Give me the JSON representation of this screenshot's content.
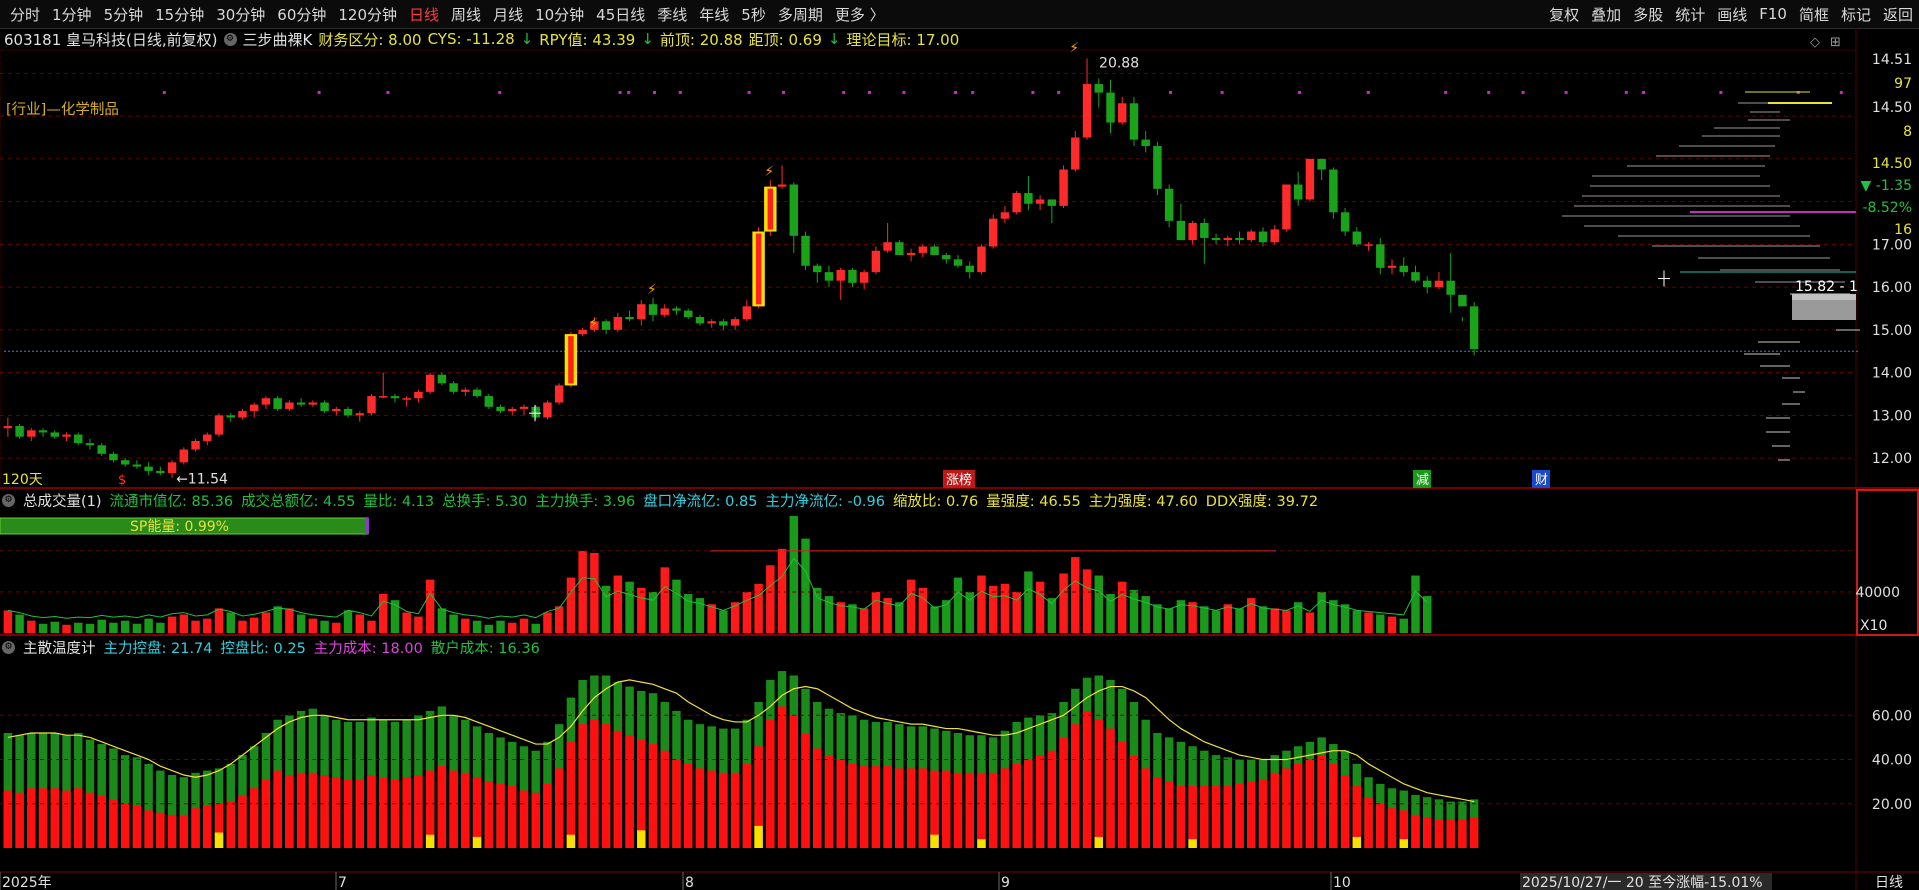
{
  "toolbar": {
    "periods": [
      "分时",
      "1分钟",
      "5分钟",
      "15分钟",
      "30分钟",
      "60分钟",
      "120分钟",
      "日线",
      "周线",
      "月线",
      "10分钟",
      "45日线",
      "季线",
      "年线",
      "5秒",
      "多周期",
      "更多 〉"
    ],
    "active_period": "日线",
    "tools": [
      "复权",
      "叠加",
      "多股",
      "统计",
      "画线",
      "F10",
      "简框",
      "标记",
      "返回"
    ]
  },
  "info_bar": {
    "code_name": "603181 皇马科技(日线,前复权)",
    "indicator": "三步曲裸K",
    "fin_score": "财务区分: 8.00",
    "cys": "CYS: -11.28",
    "rpy": "RPY值: 43.39",
    "prev_top": "前顶: 20.88",
    "dist_top": "距顶: 0.69",
    "target": "理论目标: 17.00"
  },
  "industry_label": "[行业]—化学制品",
  "main_labels": {
    "days": "120天",
    "low_marker": "←11.54",
    "high_marker": "20.88",
    "zhangbang": "涨榜",
    "jian": "减",
    "cai": "财",
    "s_mark": "$",
    "cost_price": "15.82 - 1"
  },
  "volume_bar": {
    "title": "总成交量(1)",
    "items": [
      {
        "text": "流通市值亿: 85.36",
        "color": "#20c040"
      },
      {
        "text": "成交总额亿: 4.55",
        "color": "#20c040"
      },
      {
        "text": "量比: 4.13",
        "color": "#20c040"
      },
      {
        "text": "总换手: 5.30",
        "color": "#20c040"
      },
      {
        "text": "主力换手: 3.96",
        "color": "#20c040"
      },
      {
        "text": "盘口净流亿: 0.85",
        "color": "#33d0e0"
      },
      {
        "text": "主力净流亿: -0.96",
        "color": "#33d0e0"
      },
      {
        "text": "缩放比: 0.76",
        "color": "#e8e23a"
      },
      {
        "text": "量强度: 46.55",
        "color": "#e8e23a"
      },
      {
        "text": "主力强度: 47.60",
        "color": "#e8e23a"
      },
      {
        "text": "DDX强度: 39.72",
        "color": "#e8e23a"
      }
    ],
    "sp_energy": "SP能量:   0.99%",
    "x10": "X10",
    "axis_label": "40000"
  },
  "temp_bar": {
    "title": "主散温度计",
    "items": [
      {
        "text": "主力控盘: 21.74",
        "color": "#33d0e0"
      },
      {
        "text": "控盘比: 0.25",
        "color": "#33d0e0"
      },
      {
        "text": "主力成本: 18.00",
        "color": "#e040e0"
      },
      {
        "text": "散户成本: 16.36",
        "color": "#20c040"
      }
    ]
  },
  "right_axis": {
    "top_numbers": [
      "14.51",
      "97",
      "14.50",
      "8",
      "14.50",
      "▼ -1.35",
      "-8.52%",
      "16"
    ],
    "price_ticks": [
      "17.00",
      "16.00",
      "15.00",
      "14.00",
      "13.00",
      "12.00"
    ],
    "temp_ticks": [
      "60.00",
      "40.00",
      "20.00"
    ]
  },
  "bottom_axis": {
    "labels": [
      "2025年",
      "7",
      "8",
      "9",
      "10"
    ],
    "range_text": "2025/10/27/一 20 至今涨幅-15.01%",
    "period": "日线"
  },
  "colors": {
    "up": "#ff2020",
    "down": "#1a9a1a",
    "grid": "#5a0000",
    "yellow": "#f0e000"
  },
  "chart_data": {
    "type": "candlestick",
    "ylim": [
      11.3,
      21.5
    ],
    "candles": [
      [
        12.7,
        12.95,
        12.5,
        12.75
      ],
      [
        12.75,
        12.8,
        12.45,
        12.5
      ],
      [
        12.5,
        12.7,
        12.4,
        12.65
      ],
      [
        12.65,
        12.7,
        12.5,
        12.6
      ],
      [
        12.6,
        12.65,
        12.45,
        12.5
      ],
      [
        12.5,
        12.6,
        12.4,
        12.55
      ],
      [
        12.55,
        12.6,
        12.3,
        12.35
      ],
      [
        12.35,
        12.45,
        12.2,
        12.3
      ],
      [
        12.3,
        12.35,
        12.05,
        12.1
      ],
      [
        12.1,
        12.15,
        11.9,
        11.95
      ],
      [
        11.95,
        12.0,
        11.8,
        11.85
      ],
      [
        11.85,
        11.95,
        11.75,
        11.8
      ],
      [
        11.8,
        11.9,
        11.6,
        11.7
      ],
      [
        11.7,
        11.8,
        11.6,
        11.65
      ],
      [
        11.65,
        11.95,
        11.54,
        11.9
      ],
      [
        11.9,
        12.25,
        11.85,
        12.2
      ],
      [
        12.2,
        12.45,
        12.15,
        12.4
      ],
      [
        12.4,
        12.6,
        12.3,
        12.55
      ],
      [
        12.55,
        13.05,
        12.5,
        13.0
      ],
      [
        13.0,
        13.05,
        12.85,
        12.95
      ],
      [
        12.95,
        13.15,
        12.9,
        13.1
      ],
      [
        13.1,
        13.3,
        12.95,
        13.25
      ],
      [
        13.25,
        13.45,
        13.15,
        13.4
      ],
      [
        13.4,
        13.45,
        13.1,
        13.15
      ],
      [
        13.15,
        13.35,
        13.1,
        13.3
      ],
      [
        13.3,
        13.4,
        13.2,
        13.25
      ],
      [
        13.25,
        13.35,
        13.2,
        13.3
      ],
      [
        13.3,
        13.35,
        13.05,
        13.1
      ],
      [
        13.1,
        13.2,
        13.0,
        13.15
      ],
      [
        13.15,
        13.2,
        12.95,
        13.0
      ],
      [
        13.0,
        13.1,
        12.85,
        13.05
      ],
      [
        13.05,
        13.5,
        13.0,
        13.45
      ],
      [
        13.45,
        14.0,
        13.4,
        13.45
      ],
      [
        13.45,
        13.5,
        13.3,
        13.4
      ],
      [
        13.4,
        13.45,
        13.2,
        13.4
      ],
      [
        13.4,
        13.6,
        13.3,
        13.55
      ],
      [
        13.55,
        14.0,
        13.5,
        13.95
      ],
      [
        13.95,
        14.0,
        13.7,
        13.75
      ],
      [
        13.75,
        13.8,
        13.5,
        13.55
      ],
      [
        13.55,
        13.65,
        13.45,
        13.6
      ],
      [
        13.6,
        13.65,
        13.4,
        13.45
      ],
      [
        13.45,
        13.5,
        13.15,
        13.2
      ],
      [
        13.2,
        13.25,
        13.05,
        13.1
      ],
      [
        13.1,
        13.2,
        13.0,
        13.15
      ],
      [
        13.15,
        13.25,
        13.0,
        13.2
      ],
      [
        13.2,
        13.25,
        12.9,
        12.95
      ],
      [
        12.95,
        13.35,
        12.9,
        13.3
      ],
      [
        13.3,
        13.75,
        13.25,
        13.7
      ],
      [
        13.7,
        14.95,
        13.65,
        14.9
      ],
      [
        14.9,
        15.05,
        14.85,
        15.0
      ],
      [
        15.0,
        15.3,
        14.95,
        15.2
      ],
      [
        15.2,
        15.25,
        14.9,
        15.0
      ],
      [
        15.0,
        15.4,
        14.95,
        15.3
      ],
      [
        15.3,
        15.45,
        15.2,
        15.25
      ],
      [
        15.25,
        15.7,
        15.1,
        15.6
      ],
      [
        15.6,
        15.75,
        15.2,
        15.35
      ],
      [
        15.35,
        15.6,
        15.3,
        15.5
      ],
      [
        15.5,
        15.55,
        15.35,
        15.45
      ],
      [
        15.45,
        15.5,
        15.25,
        15.3
      ],
      [
        15.3,
        15.35,
        15.1,
        15.15
      ],
      [
        15.15,
        15.25,
        15.05,
        15.2
      ],
      [
        15.2,
        15.25,
        15.0,
        15.1
      ],
      [
        15.1,
        15.3,
        15.0,
        15.25
      ],
      [
        15.25,
        15.7,
        15.2,
        15.55
      ],
      [
        15.55,
        17.4,
        15.5,
        17.3
      ],
      [
        17.3,
        18.5,
        17.2,
        18.35
      ],
      [
        18.35,
        18.85,
        18.3,
        18.4
      ],
      [
        18.4,
        18.45,
        16.8,
        17.2
      ],
      [
        17.2,
        17.3,
        16.4,
        16.5
      ],
      [
        16.5,
        16.55,
        16.1,
        16.35
      ],
      [
        16.35,
        16.5,
        16.0,
        16.15
      ],
      [
        16.15,
        16.45,
        15.7,
        16.4
      ],
      [
        16.4,
        16.45,
        16.0,
        16.1
      ],
      [
        16.1,
        16.4,
        15.95,
        16.35
      ],
      [
        16.35,
        16.95,
        16.3,
        16.85
      ],
      [
        16.85,
        17.5,
        16.8,
        17.05
      ],
      [
        17.05,
        17.1,
        16.8,
        16.75
      ],
      [
        16.75,
        16.9,
        16.6,
        16.8
      ],
      [
        16.8,
        17.0,
        16.7,
        16.95
      ],
      [
        16.95,
        17.0,
        16.75,
        16.75
      ],
      [
        16.75,
        16.8,
        16.55,
        16.65
      ],
      [
        16.65,
        16.75,
        16.45,
        16.5
      ],
      [
        16.5,
        16.6,
        16.2,
        16.35
      ],
      [
        16.35,
        17.0,
        16.3,
        16.95
      ],
      [
        16.95,
        17.7,
        16.9,
        17.6
      ],
      [
        17.6,
        17.9,
        17.5,
        17.75
      ],
      [
        17.75,
        18.25,
        17.7,
        18.2
      ],
      [
        18.2,
        18.6,
        17.8,
        17.95
      ],
      [
        17.95,
        18.15,
        17.8,
        18.05
      ],
      [
        18.05,
        17.9,
        17.5,
        17.9
      ],
      [
        17.9,
        18.85,
        17.85,
        18.75
      ],
      [
        18.75,
        19.65,
        18.7,
        19.5
      ],
      [
        19.5,
        21.35,
        19.45,
        20.75
      ],
      [
        20.75,
        20.88,
        20.2,
        20.55
      ],
      [
        20.55,
        20.85,
        19.6,
        19.85
      ],
      [
        19.85,
        20.45,
        19.8,
        20.3
      ],
      [
        20.3,
        20.45,
        19.3,
        19.45
      ],
      [
        19.45,
        19.65,
        19.15,
        19.3
      ],
      [
        19.3,
        19.4,
        18.15,
        18.3
      ],
      [
        18.3,
        18.4,
        17.4,
        17.55
      ],
      [
        17.55,
        17.95,
        17.3,
        17.1
      ],
      [
        17.1,
        17.55,
        17.0,
        17.5
      ],
      [
        17.5,
        17.6,
        16.55,
        17.15
      ],
      [
        17.15,
        17.25,
        17.0,
        17.1
      ],
      [
        17.1,
        17.2,
        16.95,
        17.15
      ],
      [
        17.15,
        17.3,
        17.0,
        17.1
      ],
      [
        17.1,
        17.35,
        17.05,
        17.3
      ],
      [
        17.3,
        17.4,
        16.95,
        17.05
      ],
      [
        17.05,
        17.45,
        17.0,
        17.35
      ],
      [
        17.35,
        18.4,
        17.3,
        18.4
      ],
      [
        18.4,
        18.7,
        17.9,
        18.05
      ],
      [
        18.05,
        19.0,
        18.0,
        19.0
      ],
      [
        19.0,
        18.95,
        18.5,
        18.75
      ],
      [
        18.75,
        18.8,
        17.6,
        17.75
      ],
      [
        17.75,
        17.85,
        17.2,
        17.3
      ],
      [
        17.3,
        17.4,
        16.95,
        17.0
      ],
      [
        17.0,
        17.05,
        16.85,
        17.0
      ],
      [
        17.0,
        17.15,
        16.3,
        16.45
      ],
      [
        16.45,
        16.65,
        16.3,
        16.5
      ],
      [
        16.5,
        16.7,
        16.25,
        16.35
      ],
      [
        16.35,
        16.5,
        16.1,
        16.15
      ],
      [
        16.15,
        16.25,
        15.85,
        16.0
      ],
      [
        16.0,
        16.35,
        15.95,
        16.15
      ],
      [
        16.15,
        16.8,
        15.4,
        15.82
      ],
      [
        15.82,
        15.3,
        15.2,
        15.55
      ],
      [
        15.55,
        15.65,
        14.4,
        14.55
      ]
    ],
    "volume": [
      22,
      18,
      12,
      9,
      11,
      8,
      10,
      9,
      13,
      10,
      12,
      9,
      14,
      10,
      16,
      18,
      12,
      14,
      24,
      20,
      12,
      15,
      20,
      26,
      24,
      18,
      14,
      12,
      10,
      22,
      18,
      12,
      38,
      32,
      20,
      16,
      52,
      24,
      18,
      14,
      12,
      8,
      12,
      10,
      14,
      9,
      20,
      26,
      54,
      80,
      78,
      46,
      56,
      50,
      44,
      40,
      64,
      52,
      38,
      34,
      28,
      22,
      30,
      40,
      48,
      66,
      82,
      114,
      92,
      44,
      36,
      30,
      28,
      24,
      40,
      34,
      30,
      52,
      44,
      26,
      32,
      54,
      40,
      56,
      46,
      48,
      40,
      60,
      50,
      34,
      58,
      74,
      62,
      56,
      38,
      50,
      42,
      36,
      28,
      24,
      32,
      30,
      26,
      22,
      28,
      24,
      34,
      26,
      24,
      22,
      30,
      20,
      40,
      32,
      28,
      22,
      20,
      18,
      16,
      14,
      56,
      36
    ],
    "temp_total": [
      52,
      51,
      52,
      52,
      52,
      51,
      52,
      49,
      47,
      45,
      42,
      41,
      38,
      35,
      33,
      32,
      34,
      35,
      36,
      38,
      42,
      46,
      52,
      58,
      60,
      62,
      63,
      60,
      58,
      57,
      57,
      59,
      58,
      57,
      58,
      60,
      62,
      64,
      60,
      58,
      55,
      52,
      50,
      48,
      46,
      44,
      48,
      56,
      68,
      76,
      78,
      78,
      75,
      73,
      71,
      70,
      66,
      62,
      58,
      56,
      55,
      54,
      54,
      58,
      66,
      76,
      80,
      78,
      72,
      66,
      63,
      61,
      60,
      58,
      57,
      57,
      56,
      55,
      55,
      54,
      53,
      52,
      51,
      51,
      50,
      53,
      57,
      59,
      60,
      61,
      66,
      72,
      77,
      78,
      76,
      72,
      66,
      58,
      52,
      50,
      48,
      46,
      44,
      42,
      41,
      40,
      40,
      40,
      42,
      44,
      46,
      48,
      50,
      47,
      44,
      38,
      32,
      29,
      27,
      26,
      24,
      23,
      22,
      21,
      21,
      22
    ],
    "temp_yellow": [
      0,
      0,
      0,
      0,
      0,
      0,
      0,
      0,
      0,
      0,
      0,
      0,
      0,
      0,
      0,
      0,
      0,
      0,
      0,
      0,
      0,
      0,
      0,
      0,
      0,
      0,
      0,
      0,
      0,
      0,
      0,
      0,
      0,
      0,
      0,
      0,
      0,
      0,
      0,
      0,
      0,
      0,
      0,
      0,
      0,
      0,
      0,
      0,
      0,
      0,
      0,
      0,
      0,
      0,
      0,
      0,
      0,
      0,
      0,
      0,
      0,
      0,
      0,
      0,
      0,
      0,
      0,
      0,
      0,
      0,
      0,
      0,
      0,
      0,
      0,
      0,
      0,
      0,
      0,
      0,
      0,
      0,
      0,
      0,
      0,
      0,
      0,
      0,
      0,
      0,
      0,
      0,
      0,
      0,
      0,
      0,
      0,
      0,
      0,
      0,
      0,
      0,
      0,
      0,
      0,
      0,
      0,
      0,
      0,
      0,
      0,
      0,
      0,
      0,
      0,
      0,
      0,
      0,
      0,
      0,
      0,
      0
    ],
    "temp_red": [
      26,
      25,
      27,
      27,
      27,
      26,
      27,
      25,
      24,
      22,
      20,
      19,
      17,
      16,
      15,
      15,
      18,
      19,
      20,
      21,
      24,
      27,
      31,
      35,
      33,
      34,
      34,
      33,
      32,
      31,
      31,
      33,
      32,
      31,
      32,
      33,
      35,
      37,
      35,
      34,
      32,
      30,
      29,
      28,
      26,
      25,
      29,
      36,
      48,
      56,
      58,
      56,
      53,
      51,
      49,
      47,
      44,
      40,
      38,
      36,
      35,
      34,
      34,
      38,
      46,
      58,
      64,
      60,
      52,
      45,
      42,
      40,
      38,
      37,
      37,
      37,
      36,
      36,
      36,
      35,
      35,
      34,
      34,
      34,
      34,
      36,
      38,
      40,
      42,
      44,
      50,
      56,
      62,
      58,
      54,
      48,
      42,
      36,
      32,
      30,
      28,
      28,
      28,
      28,
      28,
      29,
      30,
      31,
      34,
      36,
      38,
      40,
      42,
      38,
      33,
      28,
      23,
      20,
      18,
      17,
      15,
      14,
      13,
      13,
      13,
      14
    ],
    "temp_ma": [
      50,
      51,
      52,
      52,
      52,
      51,
      51,
      50,
      48,
      46,
      44,
      42,
      40,
      37,
      35,
      33,
      32,
      33,
      35,
      38,
      42,
      46,
      50,
      54,
      57,
      59,
      60,
      60,
      59,
      58,
      58,
      58,
      58,
      58,
      58,
      58,
      59,
      60,
      60,
      59,
      57,
      55,
      53,
      51,
      49,
      47,
      47,
      50,
      55,
      62,
      68,
      72,
      75,
      76,
      75,
      74,
      72,
      70,
      66,
      63,
      60,
      58,
      57,
      57,
      60,
      64,
      69,
      72,
      73,
      72,
      69,
      66,
      63,
      61,
      59,
      58,
      57,
      56,
      56,
      55,
      54,
      54,
      53,
      52,
      51,
      51,
      52,
      54,
      56,
      58,
      60,
      64,
      68,
      71,
      73,
      73,
      71,
      68,
      63,
      58,
      54,
      51,
      48,
      46,
      44,
      42,
      41,
      40,
      40,
      40,
      41,
      42,
      43,
      44,
      44,
      42,
      38,
      35,
      32,
      29,
      27,
      25,
      24,
      23,
      22,
      21
    ]
  }
}
